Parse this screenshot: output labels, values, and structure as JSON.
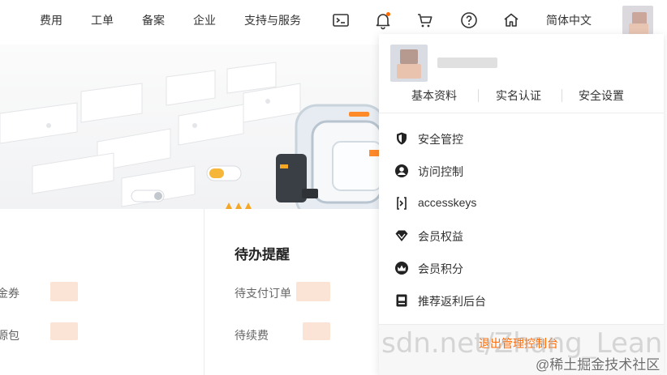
{
  "nav": {
    "items": [
      "费用",
      "工单",
      "备案",
      "企业",
      "支持与服务"
    ],
    "language": "简体中文",
    "icons": [
      "terminal-icon",
      "bell-icon",
      "cart-icon",
      "help-icon",
      "home-icon"
    ],
    "notification_dot_color": "#ff6a00"
  },
  "dropdown": {
    "profile_links": [
      "基本资料",
      "实名认证",
      "安全设置"
    ],
    "menu": [
      {
        "label": "安全管控",
        "icon": "shield-icon"
      },
      {
        "label": "访问控制",
        "icon": "user-circle-icon"
      },
      {
        "label": "accesskeys",
        "icon": "key-bracket-icon"
      },
      {
        "label": "会员权益",
        "icon": "diamond-icon"
      },
      {
        "label": "会员积分",
        "icon": "crown-icon"
      },
      {
        "label": "推荐返利后台",
        "icon": "document-icon"
      }
    ],
    "logout": "退出管理控制台"
  },
  "todo": {
    "title": "待办提醒",
    "rows": [
      "待支付订单",
      "待续费"
    ]
  },
  "left_card": {
    "rows": [
      "金券",
      "源包"
    ]
  },
  "watermark": {
    "background": "sdn.net/Zhang_Lean",
    "community": "@稀土掘金技术社区"
  },
  "colors": {
    "accent": "#ff6a00",
    "text": "#333333"
  }
}
